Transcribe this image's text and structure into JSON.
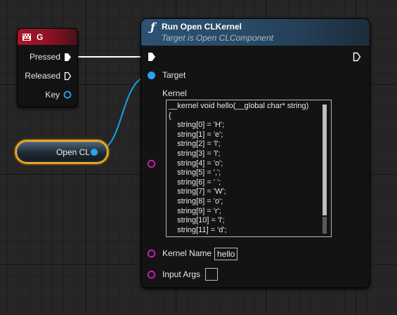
{
  "key_node": {
    "title": "G",
    "icon": "keyboard-key-icon",
    "color": "#a9152b",
    "pins": {
      "pressed": "Pressed",
      "released": "Released",
      "key": "Key"
    }
  },
  "variable_node": {
    "label": "Open CL",
    "color": "#e69c10"
  },
  "function_node": {
    "icon": "function-icon",
    "title": "Run Open CLKernel",
    "subtitle": "Target is Open CLComponent",
    "header_color": "#2c5272",
    "target_label": "Target",
    "kernel_label": "Kernel",
    "kernel_code": [
      "__kernel void hello(__global char* string)",
      "{",
      "    string[0] = 'H';",
      "    string[1] = 'e';",
      "    string[2] = 'l';",
      "    string[3] = 'l';",
      "    string[4] = 'o';",
      "    string[5] = ',';",
      "    string[6] = ' ';",
      "    string[7] = 'W';",
      "    string[8] = 'o';",
      "    string[9] = 'r';",
      "    string[10] = 'l';",
      "    string[11] = 'd';"
    ],
    "kernel_name_label": "Kernel Name",
    "kernel_name_value": "hello",
    "input_args_label": "Input Args"
  },
  "colors": {
    "exec_wire": "#ffffff",
    "object_wire": "#1aa0e8",
    "string_pin": "#d21fb5",
    "object_pin": "#2aa3f2"
  }
}
